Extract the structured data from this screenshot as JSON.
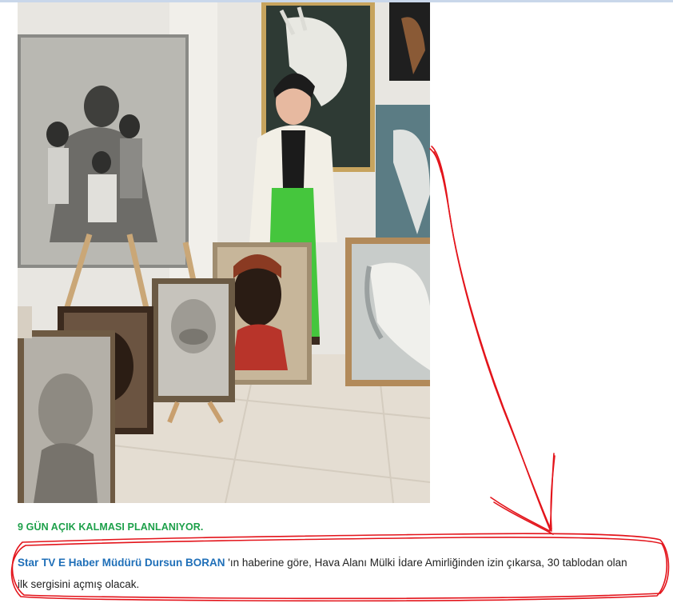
{
  "article": {
    "photo_alt": "Ressam, sergilenen tabloların arasında",
    "subheading": "9 GÜN AÇIK KALMASI PLANLANIYOR.",
    "reporter": "Star TV E Haber Müdürü Dursun BORAN",
    "body_line1": " 'ın haberine göre, Hava Alanı Mülki İdare Amirliğinden izin çıkarsa, 30 tablodan olan",
    "body_line2": "ilk sergisini açmış olacak."
  },
  "colors": {
    "subheading": "#1da04a",
    "reporter": "#1f6fb8",
    "annotation": "#e3141b",
    "body_text": "#222222"
  }
}
